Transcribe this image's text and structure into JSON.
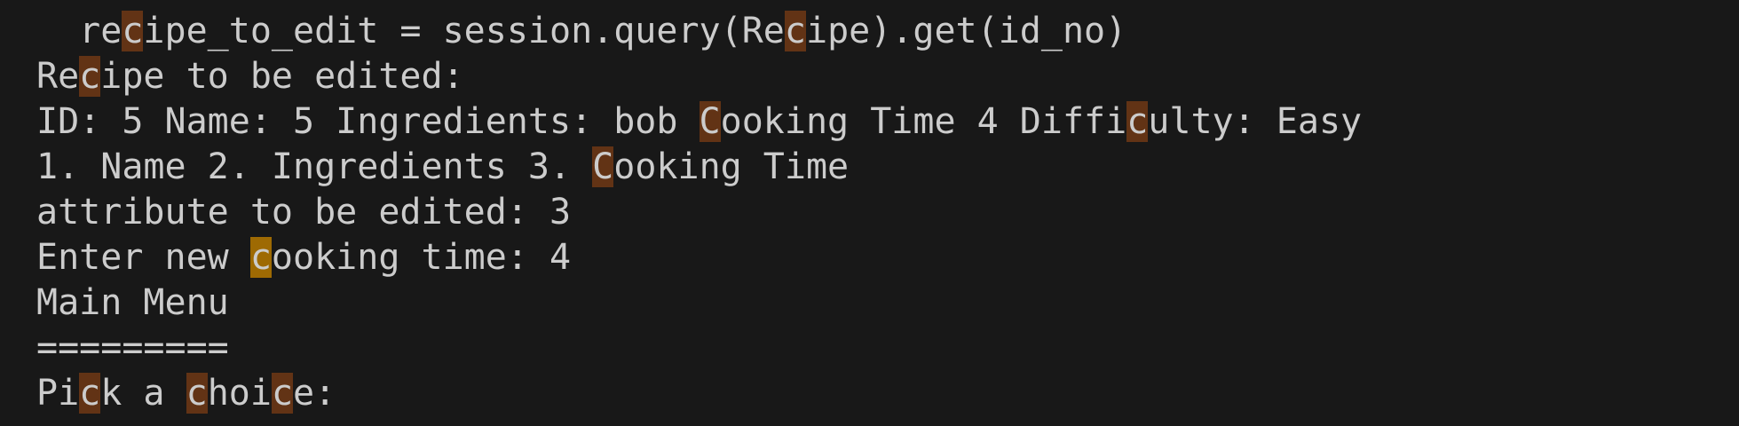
{
  "terminal": {
    "colors": {
      "background": "#181818",
      "foreground": "#cccccc",
      "find_match": "#623315",
      "find_match_active": "#9e6a03"
    },
    "lines": [
      "  recipe_to_edit = session.query(Recipe).get(id_no)",
      "Recipe to be edited:",
      "ID: 5 Name: 5 Ingredients: bob Cooking Time 4 Difficulty: Easy",
      "1. Name 2. Ingredients 3. Cooking Time",
      "attribute to be edited: 3",
      "Enter new cooking time: 4",
      "Main Menu",
      "=========",
      "Pick a choice:"
    ]
  }
}
